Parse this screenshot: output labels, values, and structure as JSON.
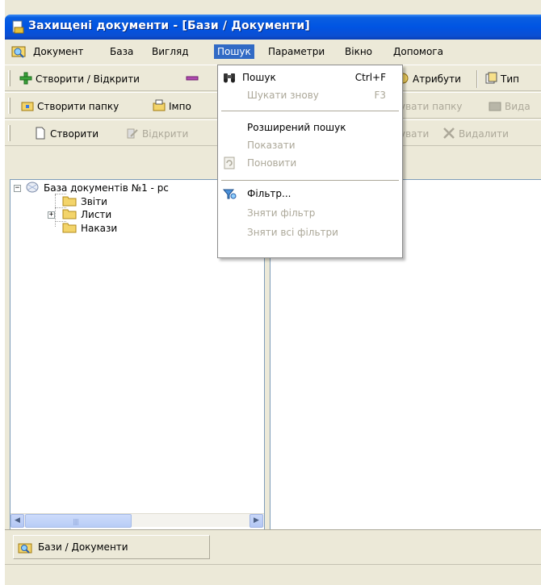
{
  "window": {
    "title": "Захищені документи - [Бази / Документи]"
  },
  "menubar": {
    "items": [
      "Документ",
      "База",
      "Вигляд",
      "Пошук",
      "Параметри",
      "Вікно",
      "Допомога"
    ],
    "active": "Пошук"
  },
  "toolbar1": {
    "create_open": "Створити / Відкрити",
    "attributes": "Атрибути",
    "types": "Тип"
  },
  "toolbar2": {
    "create_folder": "Створити папку",
    "import": "Імпо",
    "edit_folder": "увати папку",
    "delete_folder": "Вида"
  },
  "toolbar3": {
    "create": "Створити",
    "open": "Відкрити",
    "edit": "увати",
    "delete": "Видалити"
  },
  "tree": {
    "root": "База документів №1 - рс",
    "children": [
      "Звіти",
      "Листи",
      "Накази"
    ]
  },
  "dropdown": {
    "items": [
      {
        "label": "Пошук",
        "shortcut": "Ctrl+F",
        "disabled": false,
        "icon": "binoculars-icon"
      },
      {
        "label": "Шукати знову",
        "shortcut": "F3",
        "disabled": true
      },
      {
        "label": "Розширений пошук",
        "shortcut": "",
        "disabled": false
      },
      {
        "label": "Показати",
        "shortcut": "",
        "disabled": true
      },
      {
        "label": "Поновити",
        "shortcut": "",
        "disabled": true,
        "icon": "refresh-icon"
      },
      {
        "label": "Фільтр...",
        "shortcut": "",
        "disabled": false,
        "icon": "filter-icon"
      },
      {
        "label": "Зняти фільтр",
        "shortcut": "",
        "disabled": true
      },
      {
        "label": "Зняти всі фільтри",
        "shortcut": "",
        "disabled": true
      }
    ]
  },
  "tabs": {
    "active_tab": "Бази / Документи"
  },
  "colors": {
    "title_bar": "#0054e3",
    "menu_highlight": "#316ac5",
    "disabled_text": "#aca899",
    "face": "#ece9d8"
  }
}
